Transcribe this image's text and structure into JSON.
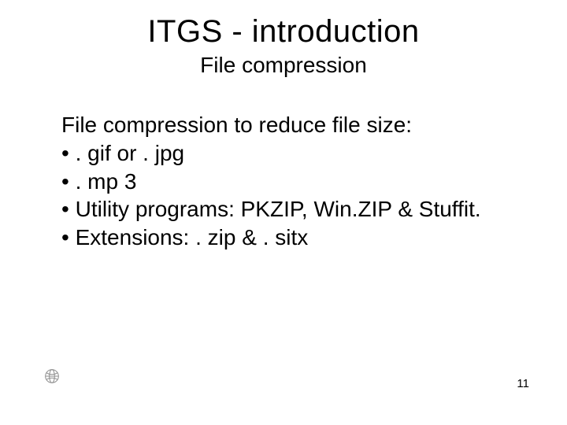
{
  "title": "ITGS - introduction",
  "subtitle": "File compression",
  "body": {
    "heading": "File compression to reduce file size:",
    "bullets": [
      ". gif or . jpg",
      ". mp 3",
      "Utility programs: PKZIP, Win.ZIP & Stuffit.",
      "Extensions: . zip & . sitx"
    ]
  },
  "icon": "globe-icon",
  "page_number": "11"
}
